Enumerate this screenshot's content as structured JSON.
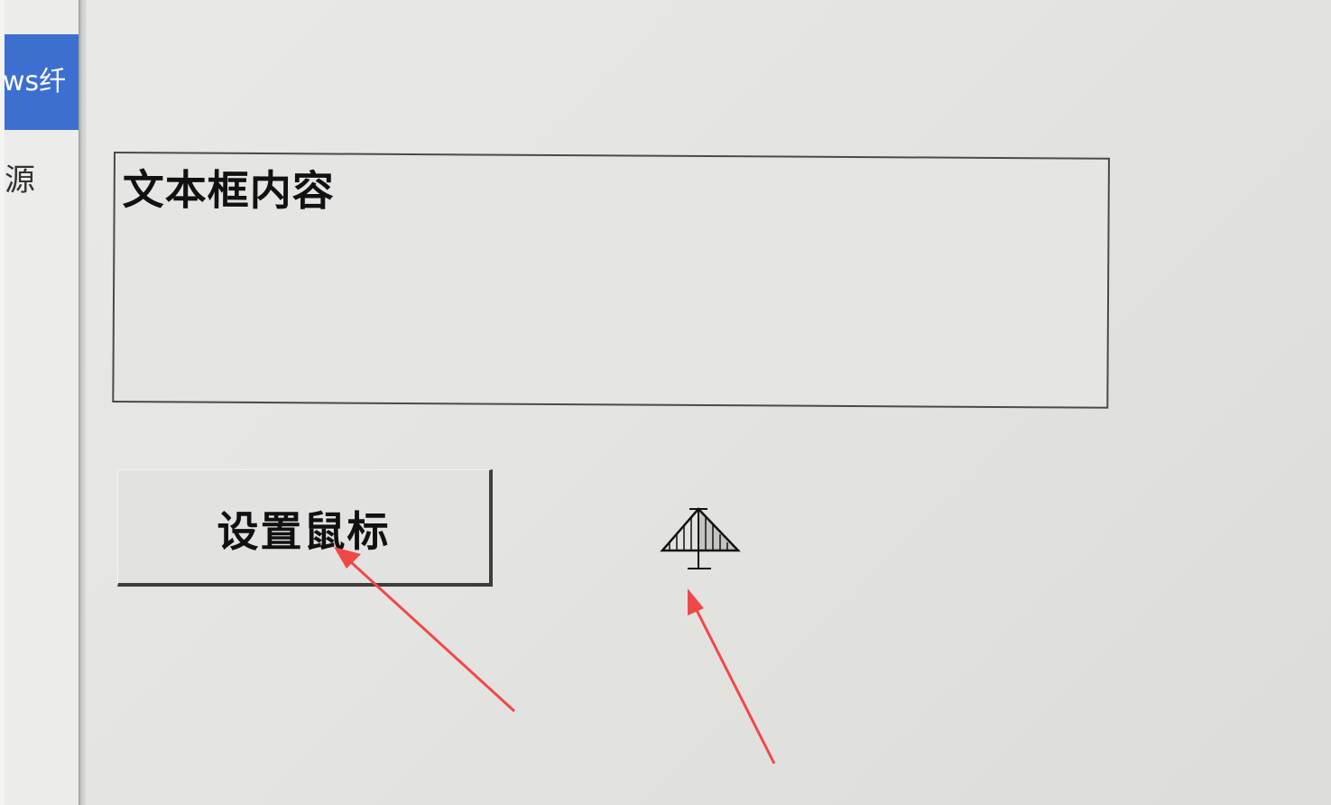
{
  "sidebar": {
    "items": [
      {
        "label": "ws纤"
      },
      {
        "label": "源"
      }
    ]
  },
  "textbox": {
    "value": "文本框内容"
  },
  "button": {
    "label": "设置鼠标"
  },
  "cursor": {
    "icon": "hang-glider-cursor-icon"
  },
  "annotations": {
    "arrow_color": "#f04848"
  },
  "colors": {
    "sidebar_active": "#3d6fd0"
  }
}
